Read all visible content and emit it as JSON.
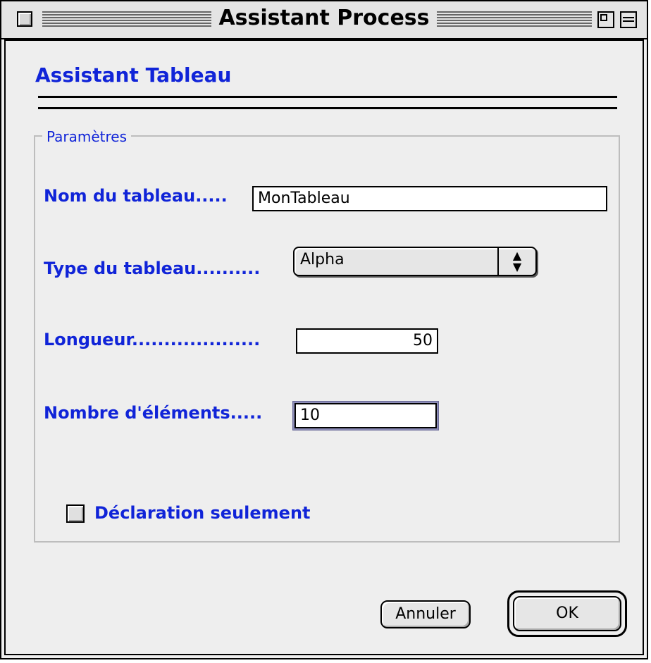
{
  "window": {
    "title": "Assistant Process"
  },
  "wizard": {
    "title": "Assistant Tableau"
  },
  "group": {
    "legend": "Paramètres"
  },
  "fields": {
    "name_label": "Nom du tableau.....",
    "name_value": "MonTableau",
    "type_label": "Type du tableau..........",
    "type_value": "Alpha",
    "length_label": "Longueur....................",
    "length_value": "50",
    "count_label": "Nombre d'éléments.....",
    "count_value": "10"
  },
  "checkbox": {
    "label": "Déclaration seulement",
    "checked": false
  },
  "buttons": {
    "cancel_label": "Annuler",
    "ok_label": "OK"
  },
  "colors": {
    "label_blue": "#1024d8",
    "window_bg": "#eeeeee",
    "group_border": "#bdbdbd"
  },
  "icons": {
    "close": "close-box-icon",
    "zoom": "zoom-box-icon",
    "collapse": "collapse-box-icon",
    "popup_arrows": "up-down-arrows-icon"
  }
}
